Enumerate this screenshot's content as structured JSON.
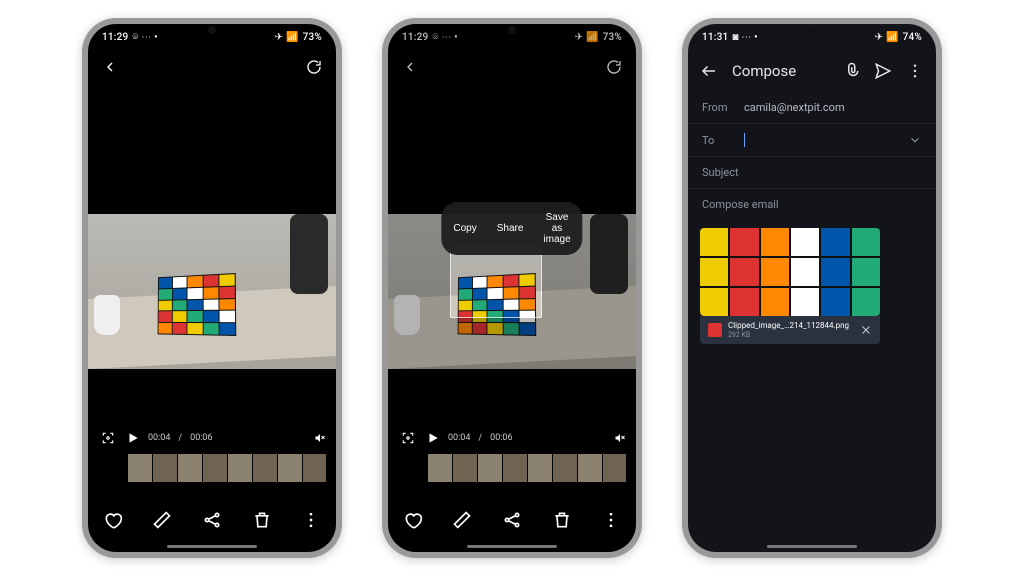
{
  "phone1": {
    "status": {
      "time": "11:29",
      "battery": "73%",
      "indicators": "⌾ ⋯ •",
      "net": "✈ 📶"
    },
    "play": {
      "elapsed": "00:04",
      "total": "00:06"
    }
  },
  "phone2": {
    "status": {
      "time": "11:29",
      "battery": "73%",
      "indicators": "⌾ ⋯ •",
      "net": "✈ 📶"
    },
    "play": {
      "elapsed": "00:04",
      "total": "00:06"
    },
    "popup": {
      "copy": "Copy",
      "share": "Share",
      "save": "Save as image"
    }
  },
  "phone3": {
    "status": {
      "time": "11:31",
      "battery": "74%",
      "indicators": "◙ ⋯ •",
      "net": "✈ 📶"
    },
    "compose": {
      "title": "Compose",
      "from_label": "From",
      "from_value": "camila@nextpit.com",
      "to_label": "To",
      "to_value": "",
      "subject_label": "Subject",
      "body_placeholder": "Compose email",
      "attachment_name": "Clipped_image_…214_112844.png",
      "attachment_size": "292 KB"
    }
  },
  "cube_colors": [
    "#d33",
    "#ec0",
    "#2a7",
    "#05a",
    "#fff",
    "#f80"
  ]
}
